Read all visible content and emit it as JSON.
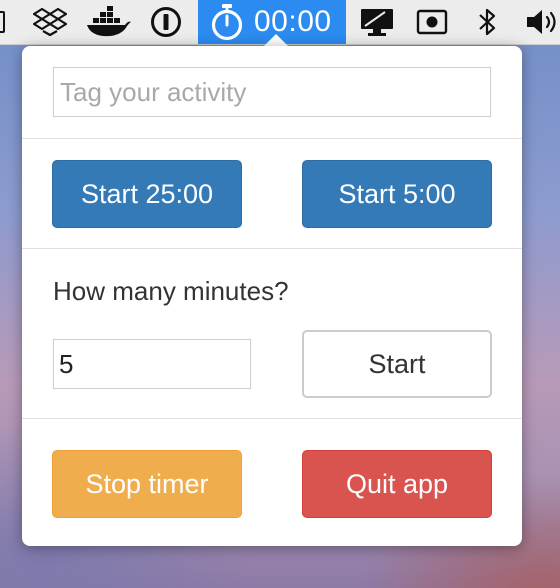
{
  "menubar": {
    "timer_text": "00:00",
    "icons": [
      "dropbox-icon",
      "docker-icon",
      "1password-icon",
      "stopwatch-icon",
      "display-icon",
      "record-icon",
      "bluetooth-icon",
      "volume-icon"
    ],
    "timer_bg_color": "#2c8bf0"
  },
  "popover": {
    "tag": {
      "placeholder": "Tag your activity",
      "value": ""
    },
    "presets": {
      "long_label": "Start 25:00",
      "short_label": "Start 5:00"
    },
    "custom": {
      "question": "How many minutes?",
      "minutes_value": "5",
      "start_label": "Start"
    },
    "actions": {
      "stop_label": "Stop timer",
      "quit_label": "Quit app"
    }
  },
  "colors": {
    "primary": "#337ab7",
    "warning": "#f0ad4e",
    "danger": "#d9534f"
  }
}
